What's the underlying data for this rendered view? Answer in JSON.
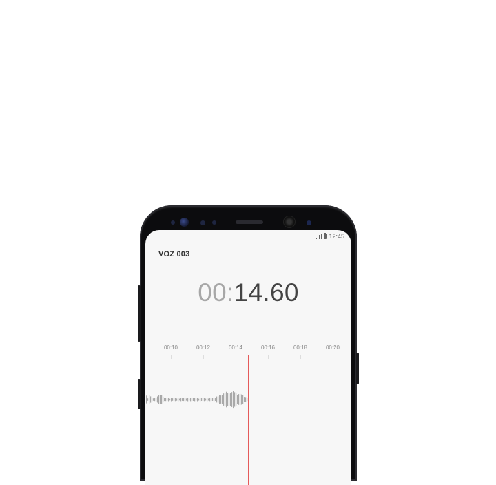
{
  "status_bar": {
    "time": "12:45",
    "icons": [
      "signal-icon",
      "battery-icon"
    ]
  },
  "recording": {
    "title": "VOZ 003"
  },
  "timer": {
    "minutes": "00",
    "separator": ":",
    "seconds": "14.60"
  },
  "timeline": {
    "labels": [
      "00:10",
      "00:12",
      "00:14",
      "00:16",
      "00:18",
      "00:20"
    ]
  },
  "colors": {
    "playhead": "#e55a5a",
    "waveform": "#a9a9a9",
    "screen_bg": "#f7f7f7"
  }
}
